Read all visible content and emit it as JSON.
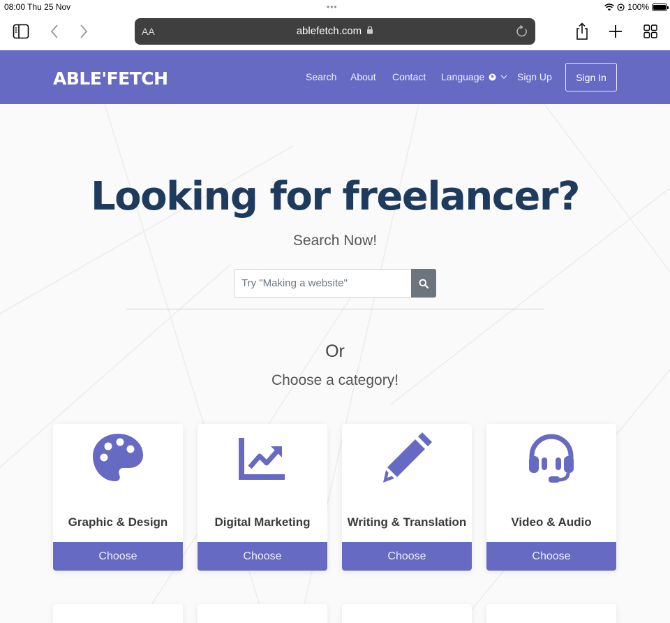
{
  "status": {
    "time": "08:00  Thu 25 Nov",
    "dots": "•••",
    "battery_text": "100%"
  },
  "browser": {
    "text_size_label": "AA",
    "url": "ablefetch.com"
  },
  "site": {
    "logo": "ABLE'FETCH",
    "nav": {
      "search": "Search",
      "about": "About",
      "contact": "Contact",
      "language": "Language",
      "signup": "Sign Up",
      "signin": "Sign In"
    }
  },
  "hero": {
    "title": "Looking for freelancer?",
    "subtitle": "Search Now!",
    "search_placeholder": "Try \"Making a website\"",
    "or": "Or",
    "choose_category": "Choose a category!"
  },
  "categories": [
    {
      "title": "Graphic & Design",
      "button": "Choose",
      "icon": "palette-icon"
    },
    {
      "title": "Digital Marketing",
      "button": "Choose",
      "icon": "chart-line-icon"
    },
    {
      "title": "Writing & Translation",
      "button": "Choose",
      "icon": "pencil-icon"
    },
    {
      "title": "Video & Audio",
      "button": "Choose",
      "icon": "headset-icon"
    }
  ],
  "colors": {
    "brand": "#676ac2",
    "title": "#1e3a5c",
    "search_button": "#6c757d"
  }
}
